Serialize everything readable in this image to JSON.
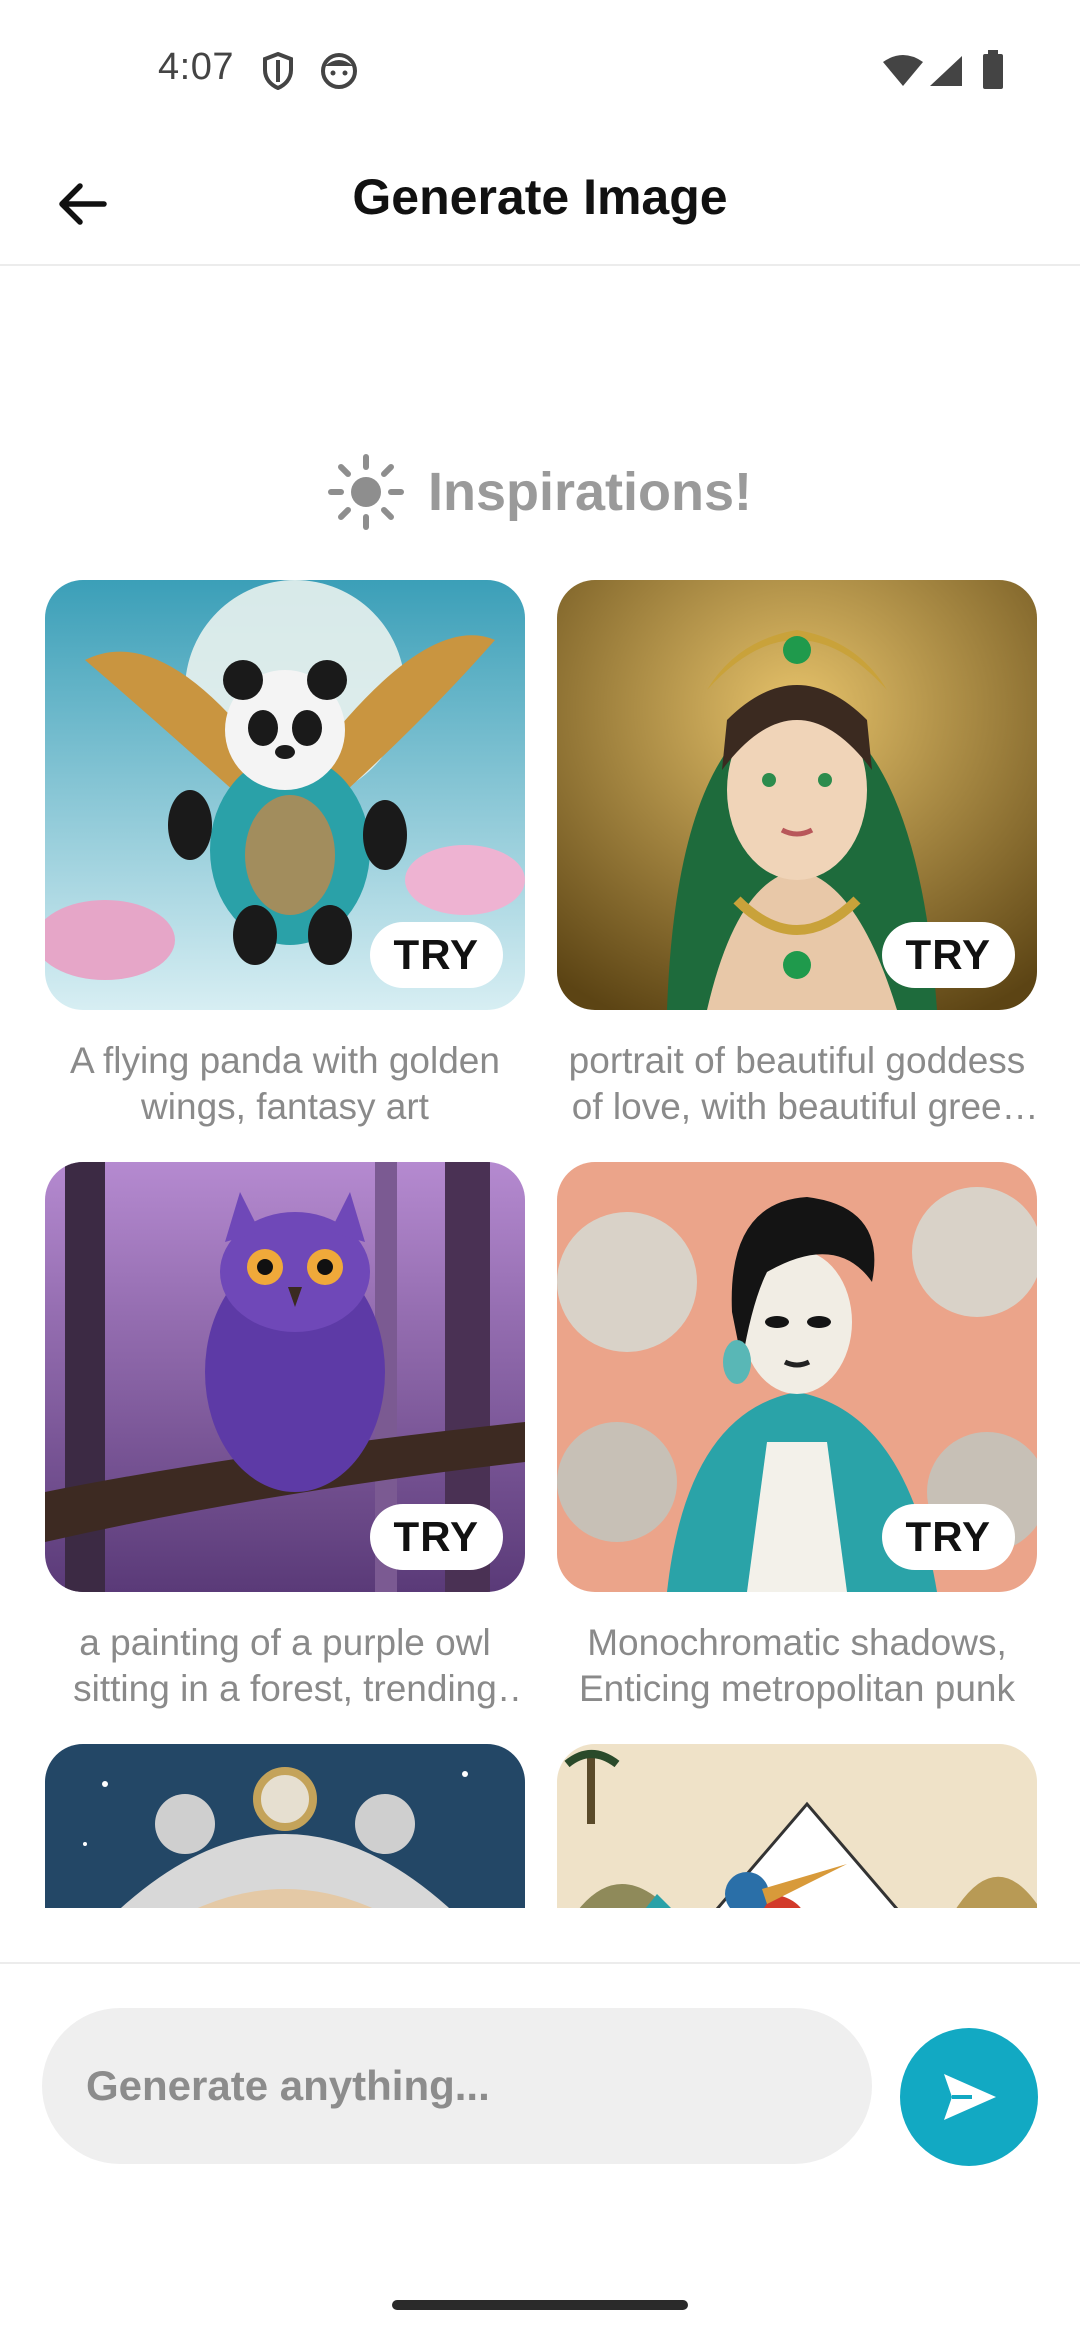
{
  "status_bar": {
    "time": "4:07",
    "icons": [
      "shield-icon",
      "face-icon",
      "wifi-icon",
      "signal-icon",
      "battery-icon"
    ]
  },
  "header": {
    "title": "Generate Image",
    "back_icon": "arrow-left-icon"
  },
  "inspirations": {
    "title": "Inspirations!",
    "icon": "sun-icon",
    "try_label": "TRY",
    "cards": [
      {
        "caption": "A flying panda with golden wings, fantasy art",
        "art": "panda"
      },
      {
        "caption": "portrait of beautiful goddess of love, with beautiful green jewelry",
        "art": "goddess"
      },
      {
        "caption": "a painting of a purple owl sitting in a forest, trending on artstation",
        "art": "owl"
      },
      {
        "caption": "Monochromatic shadows, Enticing metropolitan punk",
        "art": "punk"
      },
      {
        "caption": "",
        "art": "ornament"
      },
      {
        "caption": "",
        "art": "bird"
      }
    ]
  },
  "composer": {
    "placeholder": "Generate anything...",
    "value": "",
    "send_icon": "send-icon"
  },
  "colors": {
    "accent": "#12a9c3",
    "caption": "#8a8a8a",
    "heading_muted": "#9a9a9a",
    "input_bg": "#efefef"
  }
}
